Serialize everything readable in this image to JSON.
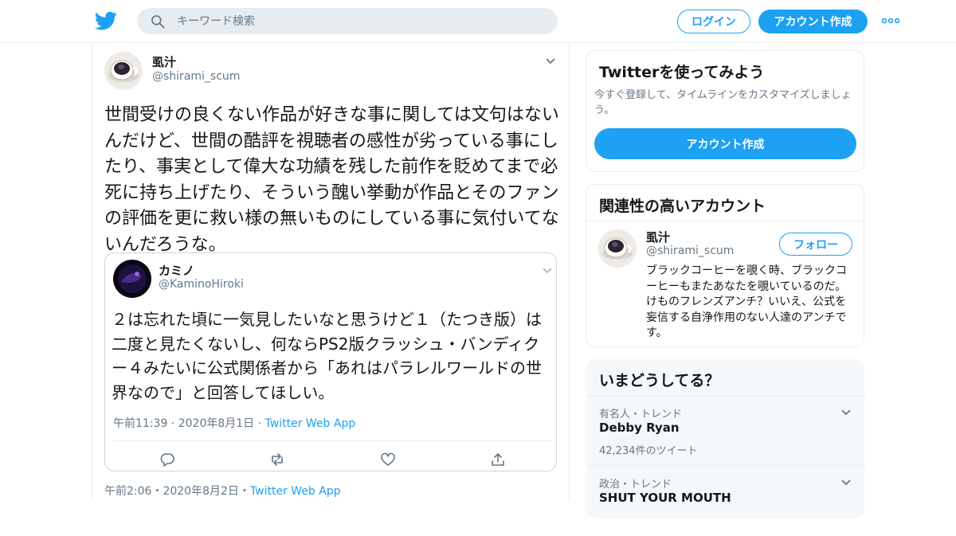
{
  "header": {
    "search_placeholder": "キーワード検索",
    "login_label": "ログイン",
    "signup_label": "アカウント作成",
    "logo_icon": "twitter-bird-icon",
    "brand_color": "#1da1f2"
  },
  "tweet": {
    "display_name": "虱汁",
    "handle": "@shirami_scum",
    "text": "世間受けの良くない作品が好きな事に関しては文句はないんだけど、世間の酷評を視聴者の感性が劣っている事にしたり、事実として偉大な功績を残した前作を貶めてまで必死に持ち上げたり、そういう醜い挙動が作品とそのファンの評価を更に救い様の無いものにしている事に気付いてないんだろうな。",
    "time": "午前2:06",
    "date": "2020年8月2日",
    "client": "Twitter Web App",
    "separator": "・"
  },
  "quote": {
    "display_name": "カミノ",
    "handle": "@KaminoHiroki",
    "text": "２は忘れた頃に一気見したいなと思うけど１（たつき版）は二度と見たくないし、何ならPS2版クラッシュ・バンディクー４みたいに公式関係者から「あれはパラレルワールドの世界なので」と回答してほしい。",
    "time": "午前11:39",
    "date": "2020年8月1日",
    "client": "Twitter Web App",
    "separator": " · "
  },
  "sidebar": {
    "signup_card": {
      "title": "Twitterを使ってみよう",
      "description": "今すぐ登録して、タイムラインをカスタマイズしましょう。",
      "button_label": "アカウント作成"
    },
    "related_card": {
      "title": "関連性の高いアカウント",
      "account": {
        "display_name": "虱汁",
        "handle": "@shirami_scum",
        "follow_label": "フォロー",
        "bio": "ブラックコーヒーを覗く時、ブラックコーヒーもまたあなたを覗いているのだ。 けものフレンズアンチ？いいえ、公式を妄信する自浄作用のない人達のアンチです。"
      }
    },
    "trends_card": {
      "title": "いまどうしてる？",
      "trends": [
        {
          "category": "有名人・トレンド",
          "name": "Debby Ryan",
          "count": "42,234件のツイート"
        },
        {
          "category": "政治・トレンド",
          "name": "SHUT YOUR MOUTH",
          "count": ""
        }
      ]
    }
  }
}
